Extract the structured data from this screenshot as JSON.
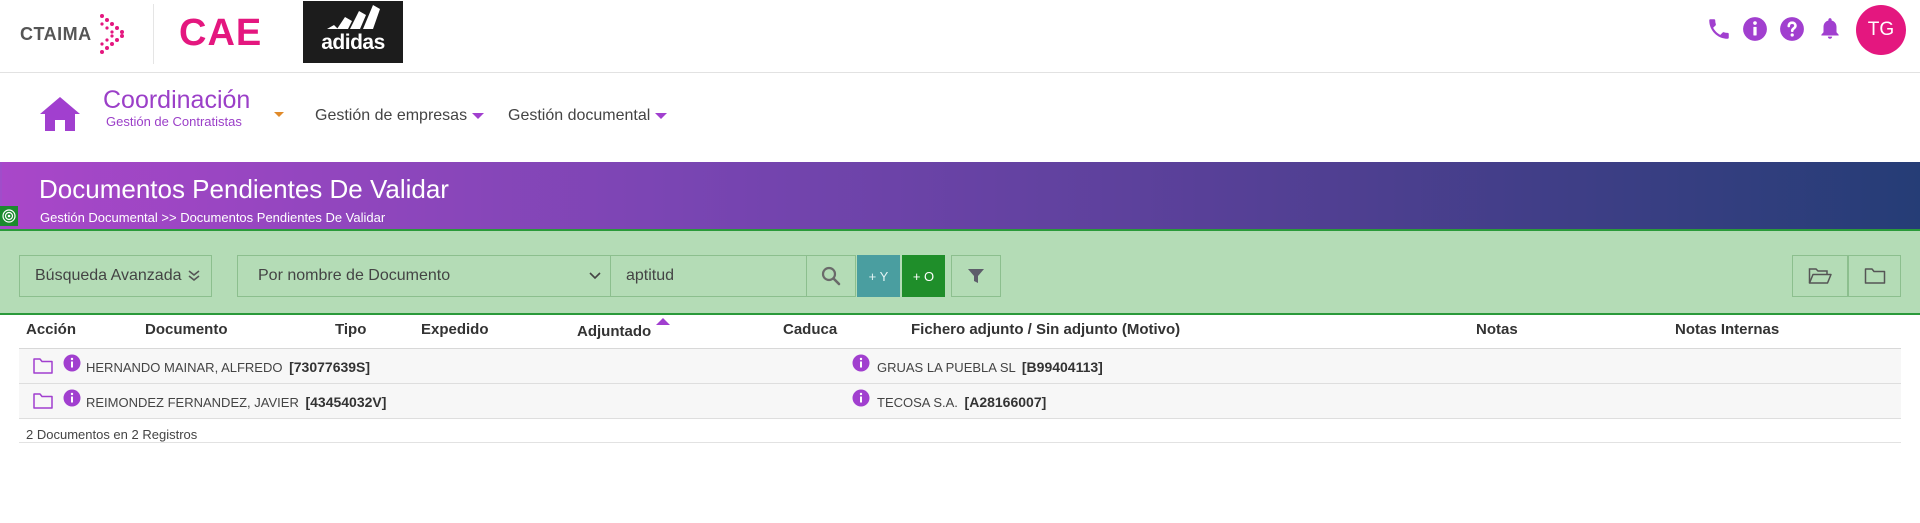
{
  "header": {
    "brand_text": "CTAIMA",
    "app_name": "CAE",
    "client_logo_text": "adidas",
    "icons": [
      "phone-icon",
      "info-icon",
      "help-icon",
      "bell-icon"
    ],
    "avatar_initials": "TG",
    "colors": {
      "accent": "#a13fcf",
      "brand_pink": "#e4177f"
    }
  },
  "nav": {
    "module_title": "Coordinación",
    "module_subtitle": "Gestión de Contratistas",
    "menus": [
      {
        "label": "Gestión de empresas"
      },
      {
        "label": "Gestión documental"
      }
    ]
  },
  "banner": {
    "title": "Documentos Pendientes De Validar",
    "breadcrumb": "Gestión Documental >> Documentos Pendientes De Validar"
  },
  "search": {
    "advanced_label": "Búsqueda Avanzada",
    "select_value": "Por nombre de Documento",
    "input_value": "aptitud",
    "and_label": "+ Y",
    "or_label": "+ O"
  },
  "table": {
    "columns": [
      "Acción",
      "Documento",
      "Tipo",
      "Expedido",
      "Adjuntado",
      "Caduca",
      "Fichero adjunto / Sin adjunto (Motivo)",
      "Notas",
      "Notas Internas"
    ],
    "sorted_column": "Adjuntado",
    "rows": [
      {
        "person": "HERNANDO MAINAR, ALFREDO",
        "person_id": "[73077639S]",
        "company": "GRUAS LA PUEBLA SL",
        "company_id": "[B99404113]"
      },
      {
        "person": "REIMONDEZ FERNANDEZ, JAVIER",
        "person_id": "[43454032V]",
        "company": "TECOSA S.A.",
        "company_id": "[A28166007]"
      }
    ],
    "summary": "2 Documentos en 2 Registros"
  }
}
